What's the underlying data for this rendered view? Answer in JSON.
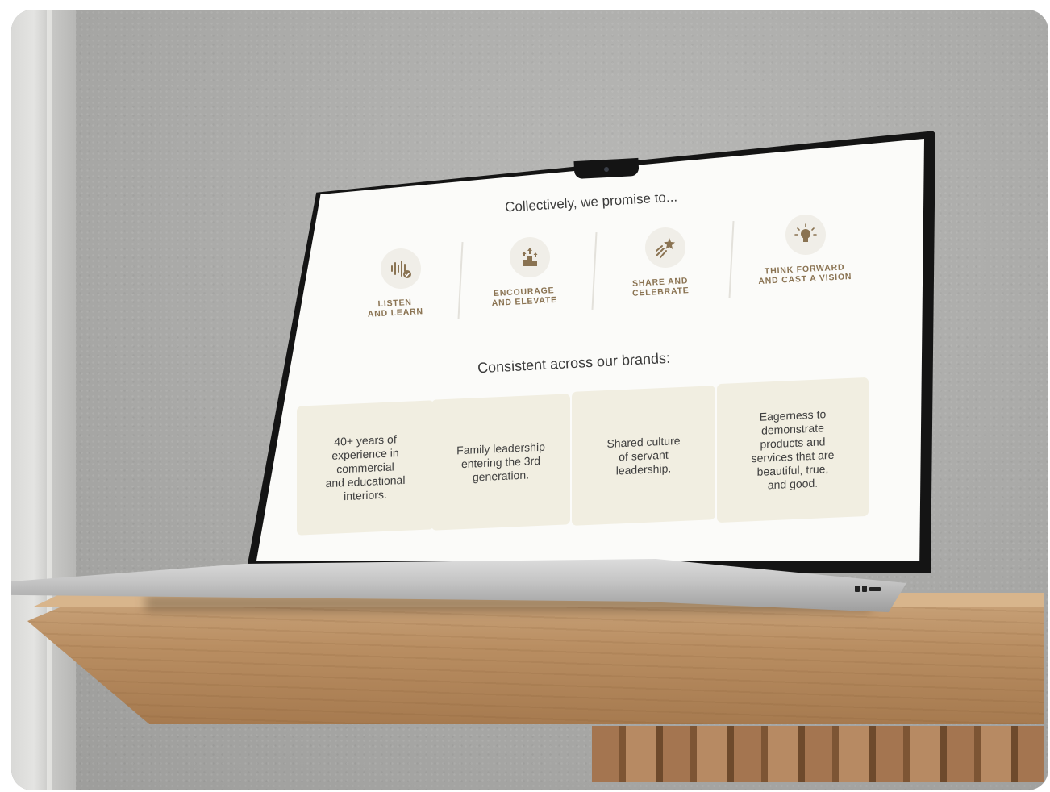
{
  "screen": {
    "promise_heading": "Collectively, we promise to...",
    "promises": [
      {
        "label": "LISTEN\nAND LEARN",
        "icon": "sound-wave-check-icon"
      },
      {
        "label": "ENCOURAGE\nAND ELEVATE",
        "icon": "podium-arrows-icon"
      },
      {
        "label": "SHARE AND\nCELEBRATE",
        "icon": "shooting-star-icon"
      },
      {
        "label": "THINK FORWARD\nAND CAST A VISION",
        "icon": "lightbulb-icon"
      }
    ],
    "brands_heading": "Consistent across our brands:",
    "cards": [
      "40+ years of\nexperience in\ncommercial\nand educational\ninteriors.",
      "Family leadership\nentering the 3rd\ngeneration.",
      "Shared culture\nof servant\nleadership.",
      "Eagerness to\ndemonstrate\nproducts and\nservices that are\nbeautiful, true,\nand good."
    ]
  },
  "colors": {
    "accent_gold": "#8a7352",
    "card_bg": "#f1eee1",
    "text_dark": "#3b3b3b"
  }
}
